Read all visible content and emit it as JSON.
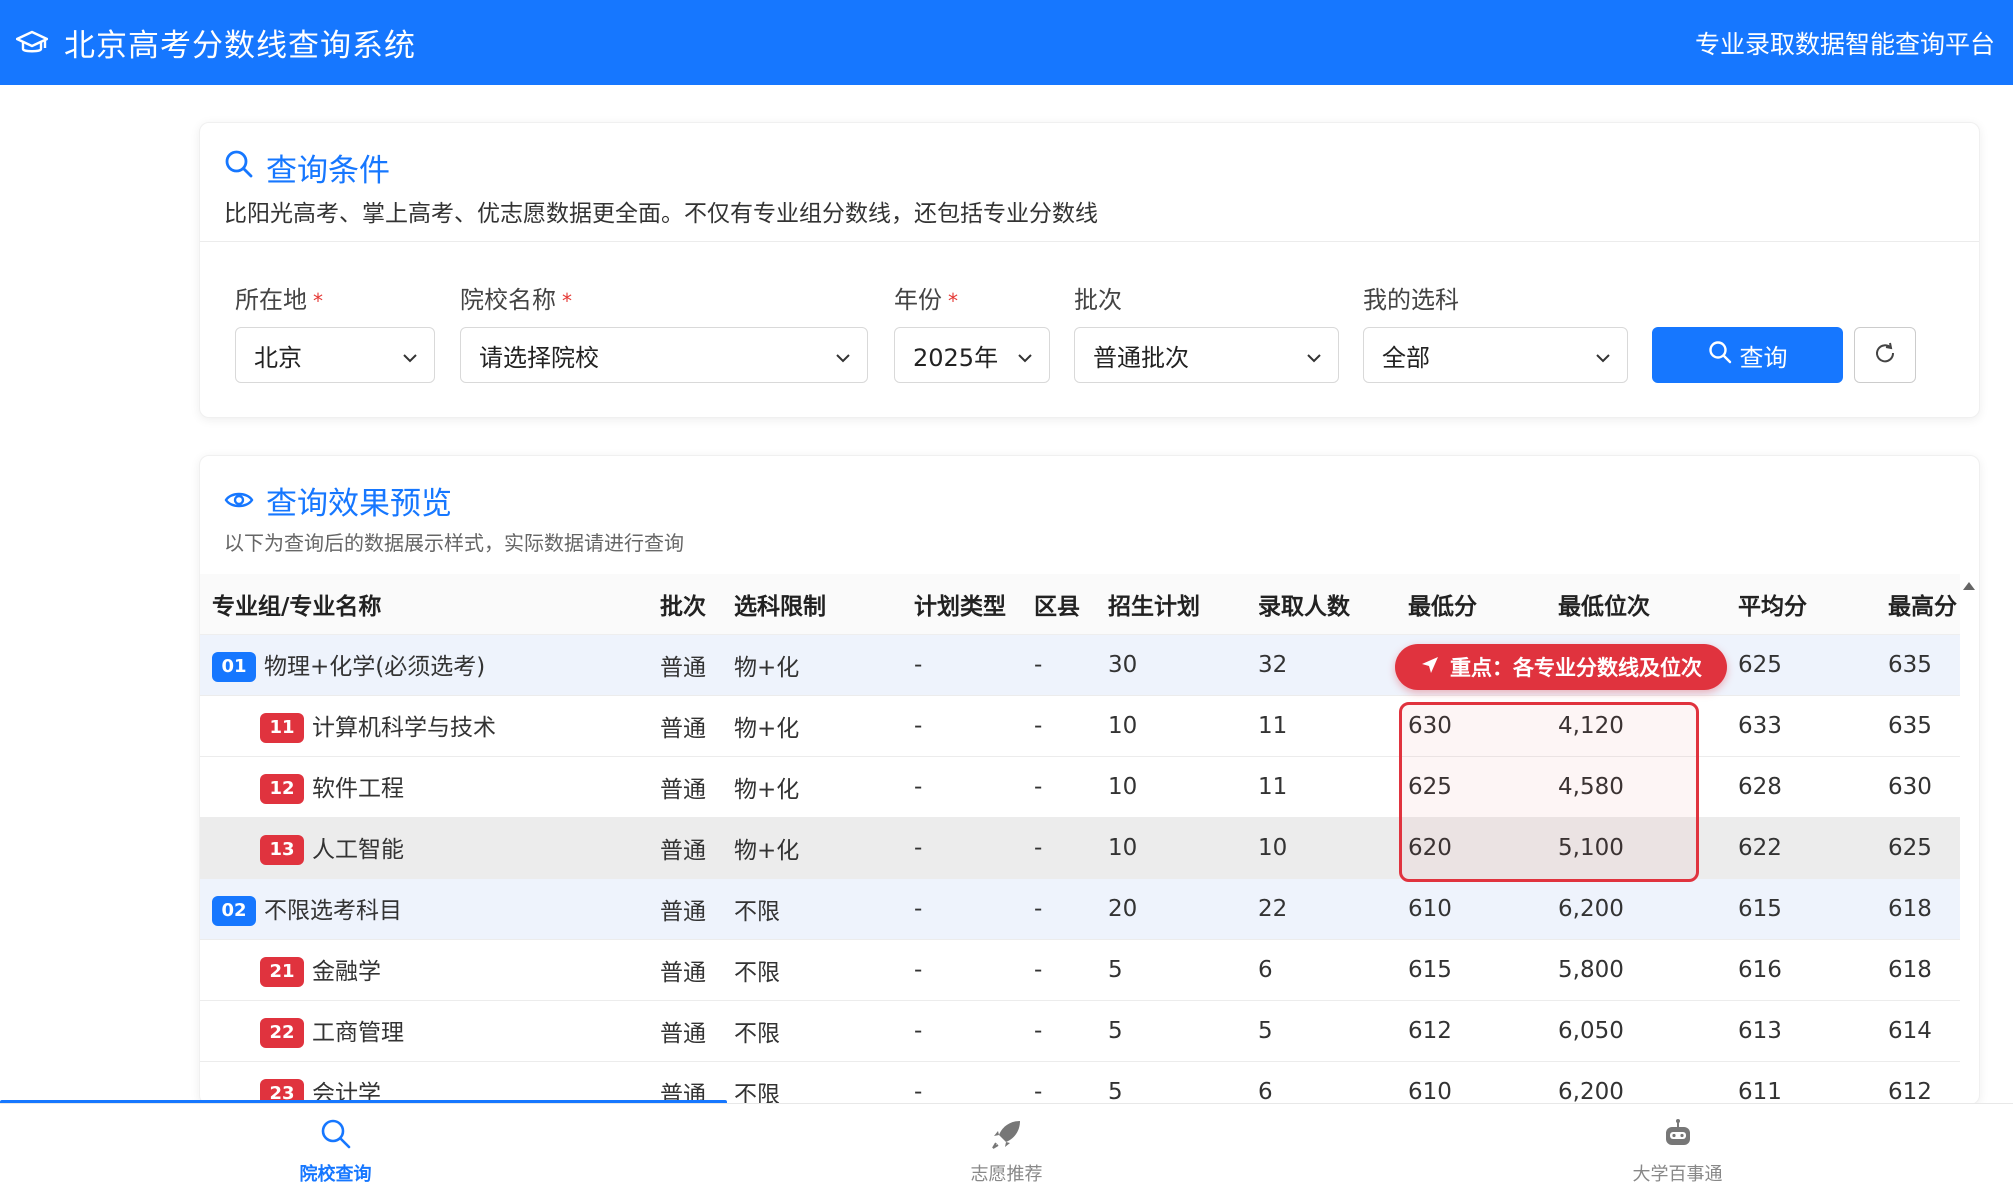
{
  "header": {
    "title": "北京高考分数线查询系统",
    "subtitle": "专业录取数据智能查询平台"
  },
  "query": {
    "title": "查询条件",
    "description": "比阳光高考、掌上高考、优志愿数据更全面。不仅有专业组分数线，还包括专业分数线",
    "fields": [
      {
        "label": "所在地",
        "required": "*",
        "value": "北京"
      },
      {
        "label": "院校名称",
        "required": "*",
        "value": "请选择院校"
      },
      {
        "label": "年份",
        "required": "*",
        "value": "2025年"
      },
      {
        "label": "批次",
        "value": "普通批次"
      },
      {
        "label": "我的选科",
        "value": "全部"
      }
    ],
    "query_button": "查询"
  },
  "preview": {
    "title": "查询效果预览",
    "description": "以下为查询后的数据展示样式，实际数据请进行查询",
    "callout": "重点：各专业分数线及位次",
    "columns": [
      "专业组/专业名称",
      "批次",
      "选科限制",
      "计划类型",
      "区县",
      "招生计划",
      "录取人数",
      "最低分",
      "最低位次",
      "平均分",
      "最高分"
    ],
    "rows": [
      {
        "code": "01",
        "name": "物理+化学(必须选考)",
        "batch": "普通",
        "subject": "物+化",
        "plan_type": "-",
        "district": "-",
        "plan": "30",
        "admitted": "32",
        "min_score": "",
        "min_rank": "",
        "avg": "625",
        "max": "635"
      },
      {
        "code": "11",
        "name": "计算机科学与技术",
        "batch": "普通",
        "subject": "物+化",
        "plan_type": "-",
        "district": "-",
        "plan": "10",
        "admitted": "11",
        "min_score": "630",
        "min_rank": "4,120",
        "avg": "633",
        "max": "635"
      },
      {
        "code": "12",
        "name": "软件工程",
        "batch": "普通",
        "subject": "物+化",
        "plan_type": "-",
        "district": "-",
        "plan": "10",
        "admitted": "11",
        "min_score": "625",
        "min_rank": "4,580",
        "avg": "628",
        "max": "630"
      },
      {
        "code": "13",
        "name": "人工智能",
        "batch": "普通",
        "subject": "物+化",
        "plan_type": "-",
        "district": "-",
        "plan": "10",
        "admitted": "10",
        "min_score": "620",
        "min_rank": "5,100",
        "avg": "622",
        "max": "625"
      },
      {
        "code": "02",
        "name": "不限选考科目",
        "batch": "普通",
        "subject": "不限",
        "plan_type": "-",
        "district": "-",
        "plan": "20",
        "admitted": "22",
        "min_score": "610",
        "min_rank": "6,200",
        "avg": "615",
        "max": "618"
      },
      {
        "code": "21",
        "name": "金融学",
        "batch": "普通",
        "subject": "不限",
        "plan_type": "-",
        "district": "-",
        "plan": "5",
        "admitted": "6",
        "min_score": "615",
        "min_rank": "5,800",
        "avg": "616",
        "max": "618"
      },
      {
        "code": "22",
        "name": "工商管理",
        "batch": "普通",
        "subject": "不限",
        "plan_type": "-",
        "district": "-",
        "plan": "5",
        "admitted": "5",
        "min_score": "612",
        "min_rank": "6,050",
        "avg": "613",
        "max": "614"
      },
      {
        "code": "23",
        "name": "会计学",
        "batch": "普通",
        "subject": "不限",
        "plan_type": "-",
        "district": "-",
        "plan": "5",
        "admitted": "6",
        "min_score": "610",
        "min_rank": "6,200",
        "avg": "611",
        "max": "612"
      }
    ]
  },
  "bottom_nav": [
    {
      "label": "院校查询",
      "icon": "search-icon",
      "active": true
    },
    {
      "label": "志愿推荐",
      "icon": "rocket-icon",
      "active": false
    },
    {
      "label": "大学百事通",
      "icon": "robot-icon",
      "active": false
    }
  ],
  "colors": {
    "primary": "#1677ff",
    "accent_red": "#e0333e",
    "group_row": "#eef3fc"
  }
}
